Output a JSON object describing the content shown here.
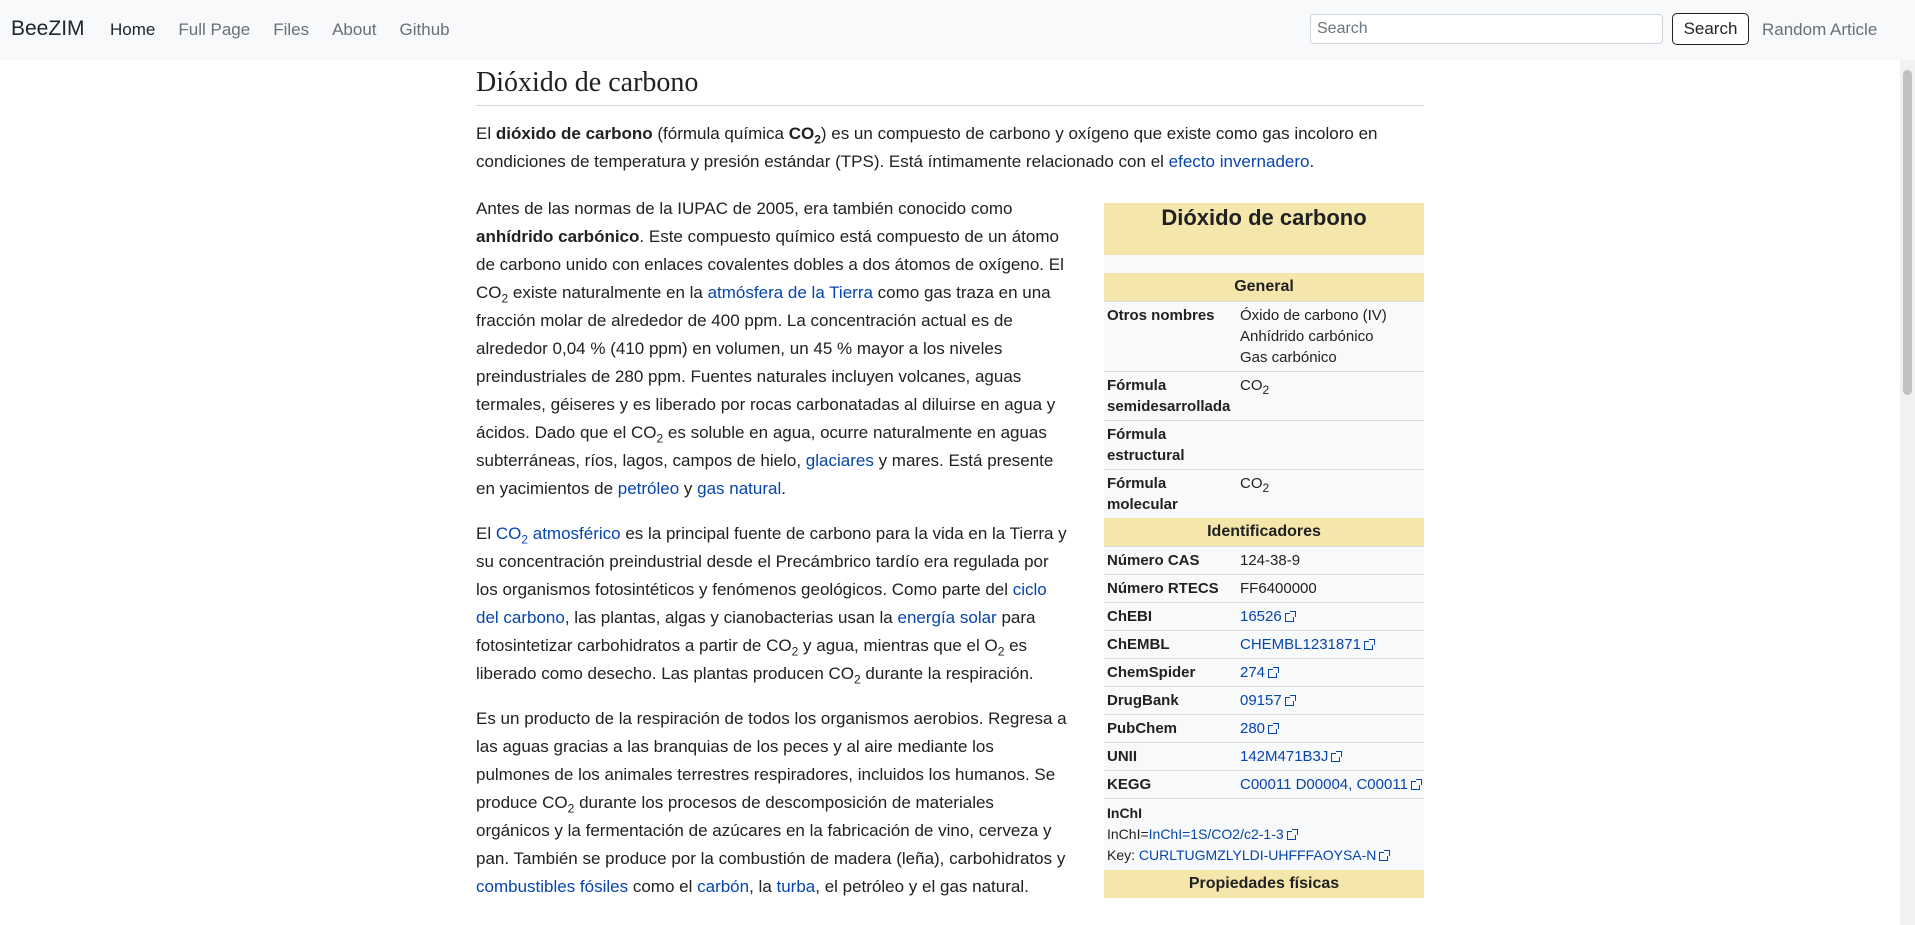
{
  "navbar": {
    "brand": "BeeZIM",
    "links": [
      "Home",
      "Full Page",
      "Files",
      "About",
      "Github"
    ],
    "search_placeholder": "Search",
    "search_button": "Search",
    "random": "Random Article"
  },
  "article": {
    "title": "Dióxido de carbono",
    "intro": {
      "t1": "El ",
      "b1": "dióxido de carbono",
      "t2": " (fórmula química ",
      "b2": "CO",
      "b2sub": "2",
      "t3": ") es un compuesto de carbono y oxígeno que existe como gas incoloro en condiciones de temperatura y presión estándar (TPS). Está íntimamente relacionado con el ",
      "l1": "efecto invernadero",
      "t4": "."
    },
    "p1": {
      "t1": "Antes de las normas de la IUPAC de 2005, era también conocido como ",
      "b1": "anhídrido carbónico",
      "t2": ". Este compuesto químico está compuesto de un átomo de carbono unido con enlaces covalentes dobles a dos átomos de oxígeno. El CO",
      "s1": "2",
      "t3": " existe naturalmente en la ",
      "l1": "atmósfera de la Tierra",
      "t4": " como gas traza en una fracción molar de alrededor de 400 ppm. La concentración actual es de alrededor 0,04 % (410 ppm) en volumen, un 45 % mayor a los niveles preindustriales de 280 ppm. Fuentes naturales incluyen volcanes, aguas termales, géiseres y es liberado por rocas carbonatadas al diluirse en agua y ácidos. Dado que el CO",
      "s2": "2",
      "t5": " es soluble en agua, ocurre naturalmente en aguas subterráneas, ríos, lagos, campos de hielo, ",
      "l2": "glaciares",
      "t6": " y mares. Está presente en yacimientos de ",
      "l3": "petróleo",
      "t7": " y ",
      "l4": "gas natural",
      "t8": "."
    },
    "p2": {
      "t1": "El ",
      "l1a": "CO",
      "l1sub": "2",
      "l1b": " atmosférico",
      "t2": " es la principal fuente de carbono para la vida en la Tierra y su concentración preindustrial desde el Precámbrico tardío era regulada por los organismos fotosintéticos y fenómenos geológicos. Como parte del ",
      "l2": "ciclo del carbono",
      "t3": ", las plantas, algas y cianobacterias usan la ",
      "l3": "energía solar",
      "t4": " para fotosintetizar carbohidratos a partir de CO",
      "s1": "2",
      "t5": " y agua, mientras que el O",
      "s2": "2",
      "t6": " es liberado como desecho. Las plantas producen CO",
      "s3": "2",
      "t7": " durante la respiración."
    },
    "p3": {
      "t1": "Es un producto de la respiración de todos los organismos aerobios. Regresa a las aguas gracias a las branquias de los peces y al aire mediante los pulmones de los animales terrestres respiradores, incluidos los humanos. Se produce CO",
      "s1": "2",
      "t2": " durante los procesos de descomposición de materiales orgánicos y la fermentación de azúcares en la fabricación de vino, cerveza y pan. También se produce por la combustión de madera (leña), carbohidratos y ",
      "l1": "combustibles fósiles",
      "t3": " como el ",
      "l2": "carbón",
      "t4": ", la ",
      "l3": "turba",
      "t5": ", el petróleo y el gas natural."
    }
  },
  "infobox": {
    "title": "Dióxido de carbono",
    "general": "General",
    "otros_k": "Otros nombres",
    "otros_v": [
      "Óxido de carbono (IV)",
      "Anhídrido carbónico",
      "Gas carbónico"
    ],
    "semi_k": "Fórmula semidesarrollada",
    "semi_v": "CO",
    "semi_sub": "2",
    "estr_k": "Fórmula estructural",
    "mol_k": "Fórmula molecular",
    "mol_v": "CO",
    "mol_sub": "2",
    "ident": "Identificadores",
    "ids": [
      {
        "k": "Número CAS",
        "v": "124-38-9"
      },
      {
        "k": "Número RTECS",
        "v": "FF6400000"
      },
      {
        "k": "ChEBI",
        "v": "16526"
      },
      {
        "k": "ChEMBL",
        "v": "CHEMBL1231871"
      },
      {
        "k": "ChemSpider",
        "v": "274"
      },
      {
        "k": "DrugBank",
        "v": "09157"
      },
      {
        "k": "PubChem",
        "v": "280"
      },
      {
        "k": "UNII",
        "v": "142M471B3J"
      },
      {
        "k": "KEGG",
        "v": "C00011 D00004, C00011"
      }
    ],
    "inchi_label": "InChI",
    "inchi_prefix": "InChI=",
    "inchi_value": "InChI=1S/CO2/c2-1-3",
    "key_prefix": "Key: ",
    "key_value": "CURLTUGMZLYLDI-UHFFFAOYSA-N",
    "fisicas": "Propiedades físicas"
  }
}
